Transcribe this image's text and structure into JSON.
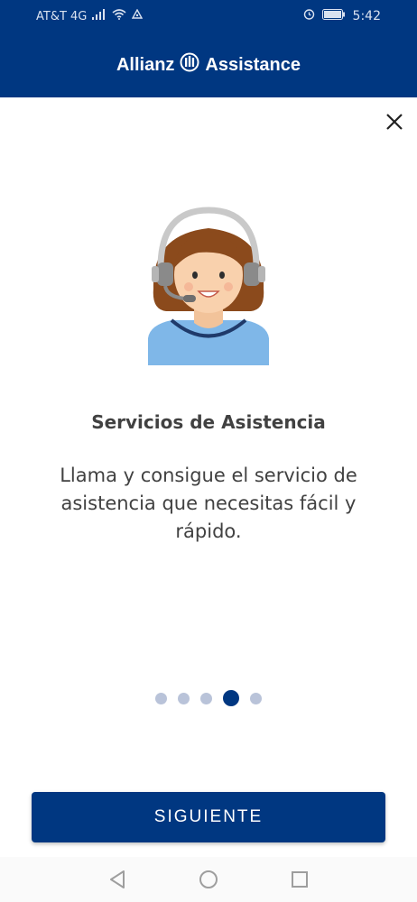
{
  "status_bar": {
    "carrier": "AT&T 4G",
    "time": "5:42"
  },
  "header": {
    "brand_left": "Allianz",
    "brand_right": "Assistance"
  },
  "content": {
    "title": "Servicios de Asistencia",
    "description": "Llama y consigue el servicio de asistencia que necesitas fácil y rápido."
  },
  "pager": {
    "total": 5,
    "active_index": 3
  },
  "actions": {
    "next_label": "SIGUIENTE"
  },
  "colors": {
    "brand_blue": "#003781",
    "dot_inactive": "#b9c3d9",
    "text": "#414141"
  },
  "icons": [
    "signal-icon",
    "wifi-icon",
    "alarm-icon",
    "battery-icon",
    "close-icon",
    "back-icon",
    "home-icon",
    "recents-icon"
  ]
}
